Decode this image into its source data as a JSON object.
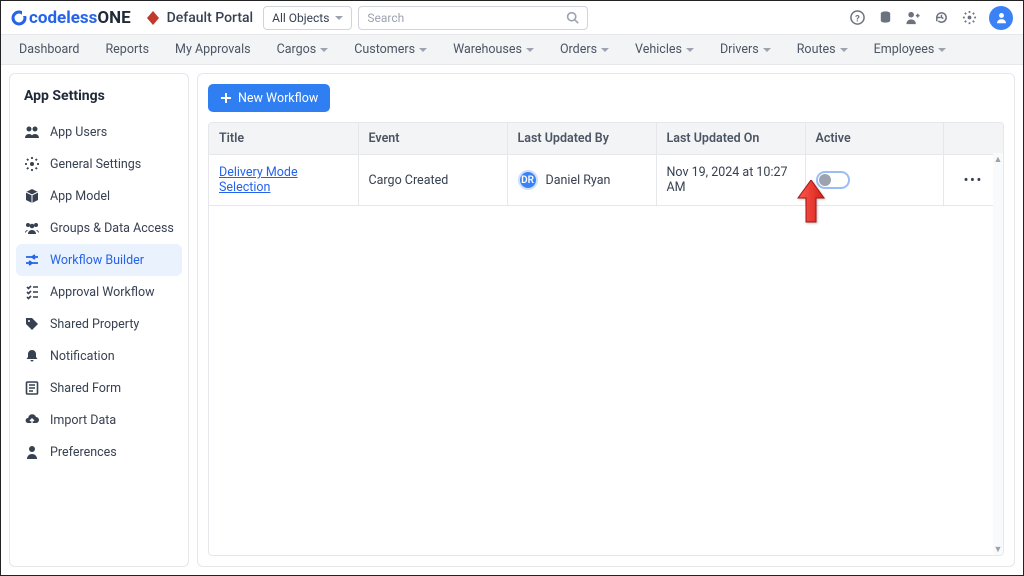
{
  "brand": {
    "text_a": "codeless",
    "text_b": "ONE"
  },
  "portal": {
    "name": "Default Portal"
  },
  "object_select": {
    "label": "All Objects"
  },
  "search": {
    "placeholder": "Search"
  },
  "nav": [
    {
      "label": "Dashboard",
      "has_caret": false
    },
    {
      "label": "Reports",
      "has_caret": false
    },
    {
      "label": "My Approvals",
      "has_caret": false
    },
    {
      "label": "Cargos",
      "has_caret": true
    },
    {
      "label": "Customers",
      "has_caret": true
    },
    {
      "label": "Warehouses",
      "has_caret": true
    },
    {
      "label": "Orders",
      "has_caret": true
    },
    {
      "label": "Vehicles",
      "has_caret": true
    },
    {
      "label": "Drivers",
      "has_caret": true
    },
    {
      "label": "Routes",
      "has_caret": true
    },
    {
      "label": "Employees",
      "has_caret": true
    }
  ],
  "sidebar": {
    "title": "App Settings",
    "items": [
      {
        "label": "App Users"
      },
      {
        "label": "General Settings"
      },
      {
        "label": "App Model"
      },
      {
        "label": "Groups & Data Access"
      },
      {
        "label": "Workflow Builder"
      },
      {
        "label": "Approval Workflow"
      },
      {
        "label": "Shared Property"
      },
      {
        "label": "Notification"
      },
      {
        "label": "Shared Form"
      },
      {
        "label": "Import Data"
      },
      {
        "label": "Preferences"
      }
    ]
  },
  "content": {
    "new_workflow_label": "New Workflow",
    "columns": {
      "title": "Title",
      "event": "Event",
      "last_updated_by": "Last Updated By",
      "last_updated_on": "Last Updated On",
      "active": "Active"
    },
    "rows": [
      {
        "title": "Delivery Mode Selection",
        "event": "Cargo Created",
        "user_initials": "DR",
        "user_name": "Daniel Ryan",
        "updated_on": "Nov 19, 2024 at 10:27 AM",
        "active": false
      }
    ]
  }
}
